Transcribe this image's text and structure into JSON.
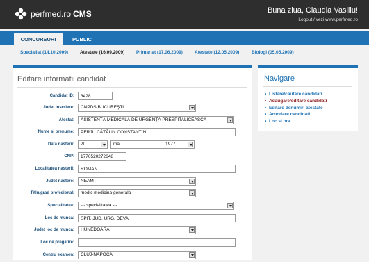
{
  "header": {
    "brand": "perfmed.ro",
    "product": "CMS",
    "greeting": "Buna ziua, Claudia Vasiliu!",
    "sub_links": "Logout / vezi www.perfmed.ro"
  },
  "tabs": [
    {
      "label": "CONCURSURI",
      "active": true
    },
    {
      "label": "PUBLIC",
      "active": false
    }
  ],
  "subnav": [
    {
      "label": "Specialist (14.10.2009)",
      "active": false
    },
    {
      "label": "Atestate (16.09.2009)",
      "active": true
    },
    {
      "label": "Primariat (17.06.2009)",
      "active": false
    },
    {
      "label": "Atestate (12.05.2009)",
      "active": false
    },
    {
      "label": "Biologi (05.05.2009)",
      "active": false
    }
  ],
  "form": {
    "title": "Editare informatii candidat",
    "fields": [
      {
        "label": "Candidat ID:",
        "value": "3428"
      },
      {
        "label": "Judet inscriere:",
        "value": "CNPDS BUCUREŞTI"
      },
      {
        "label": "Atestat:",
        "value": "ASISTENȚĂ MEDICALĂ DE URGENȚĂ PRESPITALICEASCĂ"
      },
      {
        "label": "Nume si prenume:",
        "value": "PERJU CĂTĂLIN CONSTANTIN"
      },
      {
        "label": "Data nasterii:",
        "day": "20",
        "month": "mai",
        "year": "1977"
      },
      {
        "label": "CNP:",
        "value": "1770520272648"
      },
      {
        "label": "Localitatea nasterii:",
        "value": "ROMAN"
      },
      {
        "label": "Judet nastere:",
        "value": "NEAMȚ"
      },
      {
        "label": "Titlu/grad profesional:",
        "value": "medic medicina generala"
      },
      {
        "label": "Specialitatea:",
        "value": "--- specialitatea ---"
      },
      {
        "label": "Loc de munca:",
        "value": "SPIT. JUD. URG. DEVA"
      },
      {
        "label": "Judet loc de munca:",
        "value": "HUNEDOARA"
      },
      {
        "label": "Loc de pregatire:",
        "value": ""
      },
      {
        "label": "Centru examen:",
        "value": "CLUJ-NAPOCA"
      }
    ]
  },
  "nav": {
    "title": "Navigare",
    "items": [
      {
        "label": "Listare/cautare candidati",
        "current": false
      },
      {
        "label": "Adaugare/editare candidati",
        "current": true
      },
      {
        "label": "Editare denumiri atestate",
        "current": false
      },
      {
        "label": "Arondare candidati",
        "current": false
      },
      {
        "label": "Loc si ora",
        "current": false
      }
    ]
  },
  "colors": {
    "accent": "#1f73b5",
    "header_bg": "#2e2e2e",
    "current_nav": "#8b1a1a"
  }
}
